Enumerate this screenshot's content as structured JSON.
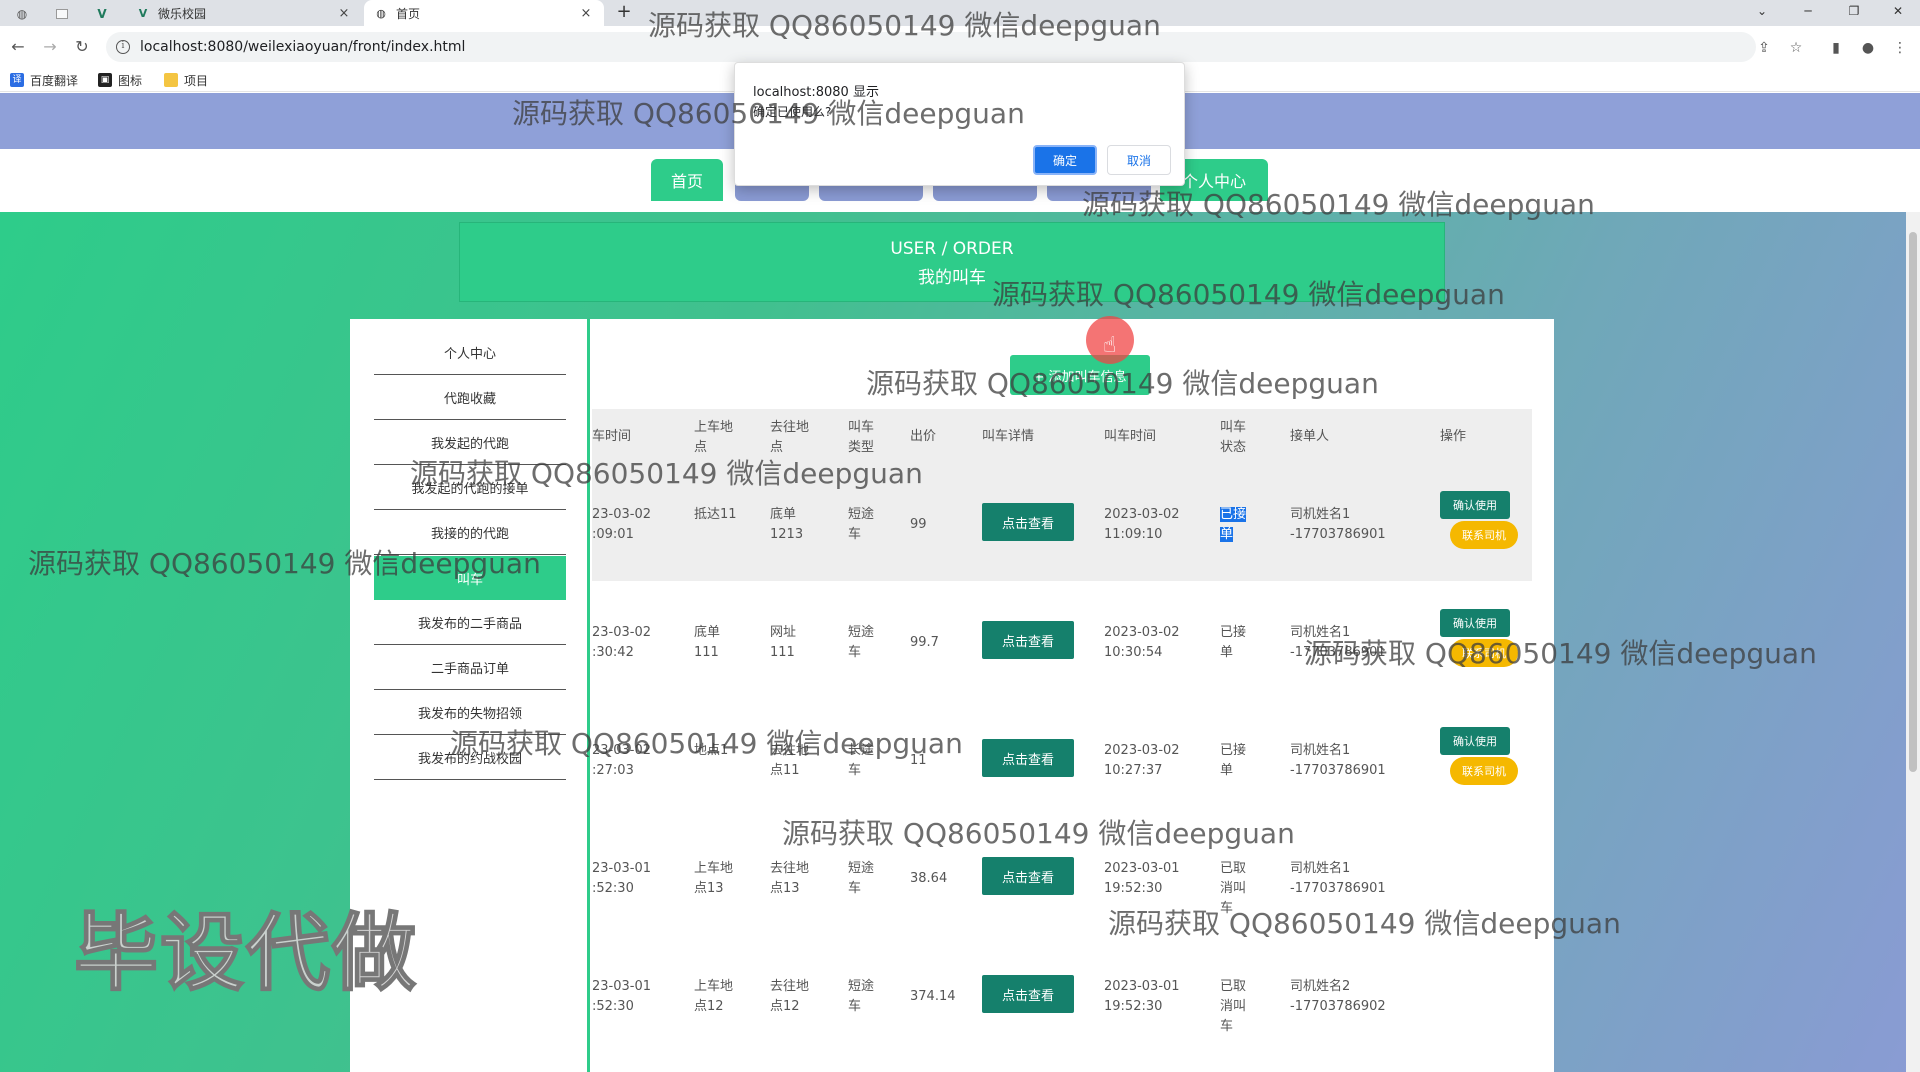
{
  "browser": {
    "tabs": [
      {
        "title": "",
        "type": "pinned",
        "icon": "globe-icon"
      },
      {
        "title": "",
        "type": "pinned",
        "icon": "blank-page-icon"
      },
      {
        "title": "",
        "type": "pinned",
        "icon": "vue-icon"
      },
      {
        "title": "微乐校园",
        "type": "normal",
        "icon": "vue-icon",
        "close": "×"
      },
      {
        "title": "首页",
        "type": "active",
        "icon": "globe-icon",
        "close": "×"
      }
    ],
    "new_tab": "+",
    "url": "localhost:8080/weilexiaoyuan/front/index.html",
    "bookmarks": [
      "百度翻译",
      "图标",
      "项目"
    ]
  },
  "dialog": {
    "title": "localhost:8080 显示",
    "message": "确定已使用么?",
    "ok": "确定",
    "cancel": "取消"
  },
  "nav": {
    "home": "首页",
    "personal": "个人中心"
  },
  "header": {
    "en": "USER / ORDER",
    "cn": "我的叫车"
  },
  "sidebar": [
    {
      "label": "个人中心",
      "active": false
    },
    {
      "label": "代跑收藏",
      "active": false
    },
    {
      "label": "我发起的代跑",
      "active": false
    },
    {
      "label": "我发起的代跑的接单",
      "active": false
    },
    {
      "label": "我接的的代跑",
      "active": false
    },
    {
      "label": "叫车",
      "active": true
    },
    {
      "label": "我发布的二手商品",
      "active": false
    },
    {
      "label": "二手商品订单",
      "active": false
    },
    {
      "label": "我发布的失物招领",
      "active": false
    },
    {
      "label": "我发布的约战校园",
      "active": false
    }
  ],
  "add_button": "+ 添加叫车信息",
  "table": {
    "headers": [
      "车时间",
      "上车地点",
      "去往地点",
      "叫车类型",
      "出价",
      "叫车详情",
      "叫车时间",
      "叫车状态",
      "接单人",
      "操作"
    ],
    "view_label": "点击查看",
    "confirm_label": "确认使用",
    "contact_label": "联系司机",
    "rows": [
      {
        "time_a": "23-03-02",
        "time_b": ":09:01",
        "pickup": "抵达11",
        "dest": "底单1213",
        "type": "短途车",
        "price": "99",
        "call_time": "2023-03-02 11:09:10",
        "status": "已接单",
        "driver": "司机姓名1",
        "phone": "-17703786901",
        "actions": true
      },
      {
        "time_a": "23-03-02",
        "time_b": ":30:42",
        "pickup": "底单111",
        "dest": "网址111",
        "type": "短途车",
        "price": "99.7",
        "call_time": "2023-03-02 10:30:54",
        "status": "已接单",
        "driver": "司机姓名1",
        "phone": "-17703786901",
        "actions": true
      },
      {
        "time_a": "23-03-02",
        "time_b": ":27:03",
        "pickup": "地点1",
        "dest": "去往地点11",
        "type": "长途车",
        "price": "11",
        "call_time": "2023-03-02 10:27:37",
        "status": "已接单",
        "driver": "司机姓名1",
        "phone": "-17703786901",
        "actions": true
      },
      {
        "time_a": "23-03-01",
        "time_b": ":52:30",
        "pickup": "上车地点13",
        "dest": "去往地点13",
        "type": "短途车",
        "price": "38.64",
        "call_time": "2023-03-01 19:52:30",
        "status": "已取消叫车",
        "driver": "司机姓名1",
        "phone": "-17703786901",
        "actions": false
      },
      {
        "time_a": "23-03-01",
        "time_b": ":52:30",
        "pickup": "上车地点12",
        "dest": "去往地点12",
        "type": "短途车",
        "price": "374.14",
        "call_time": "2023-03-01 19:52:30",
        "status": "已取消叫车",
        "driver": "司机姓名2",
        "phone": "-17703786902",
        "actions": false
      }
    ]
  },
  "watermarks": {
    "repeat_text": "源码获取 QQ86050149 微信deepguan",
    "big_text": "毕设代做"
  }
}
